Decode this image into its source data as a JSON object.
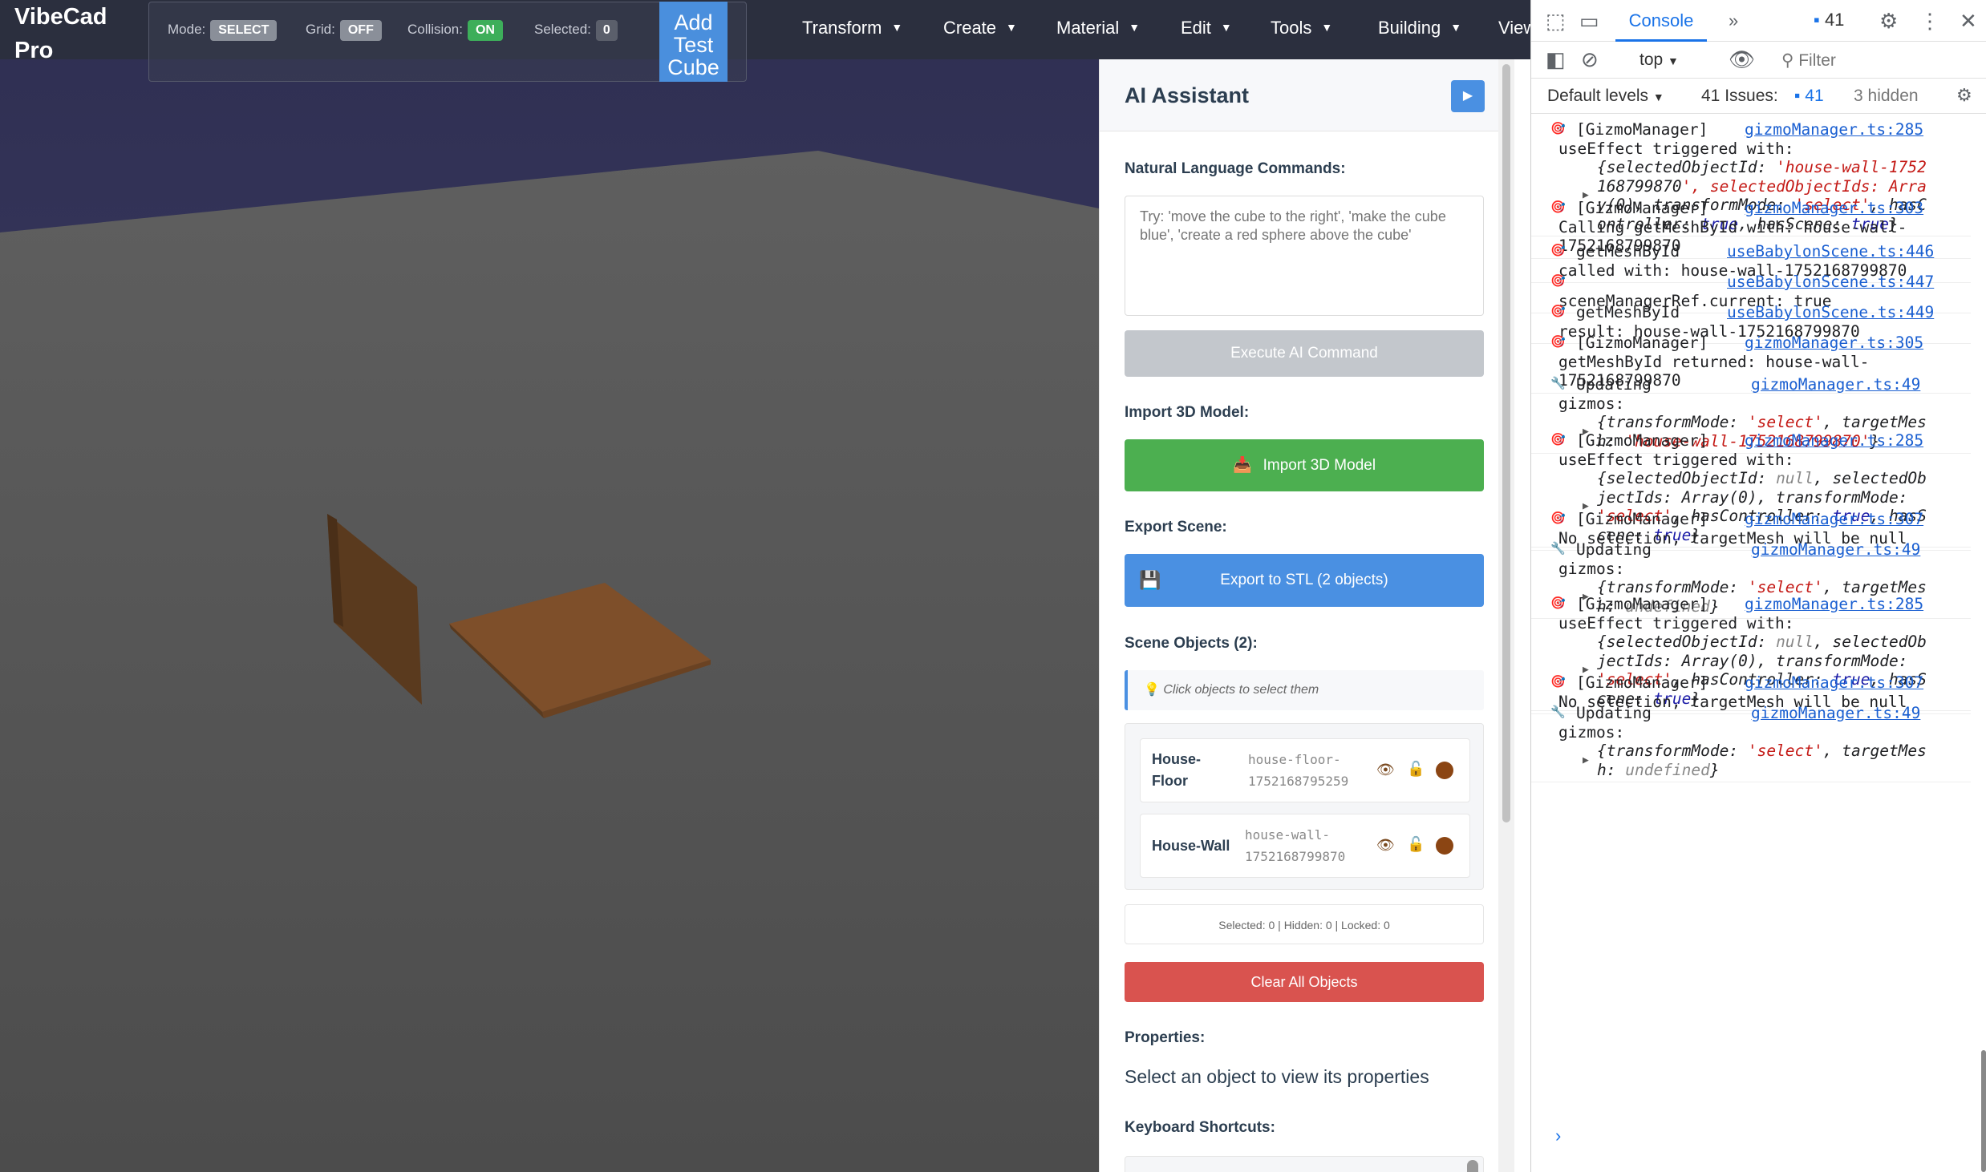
{
  "app": {
    "brand": "VibeCad Pro",
    "status": {
      "mode_label": "Mode:",
      "mode_value": "SELECT",
      "grid_label": "Grid:",
      "grid_value": "OFF",
      "collision_label": "Collision:",
      "collision_value": "ON",
      "selected_label": "Selected:",
      "selected_value": "0"
    },
    "add_cube_label": "Add Test Cube",
    "menus": [
      "Transform",
      "Create",
      "Material",
      "Edit",
      "Tools",
      "Building",
      "View"
    ]
  },
  "panel": {
    "title": "AI Assistant",
    "run_icon": "play-icon",
    "nl_label": "Natural Language Commands:",
    "nl_placeholder": "Try: 'move the cube to the right', 'make the cube blue', 'create a red sphere above the cube'",
    "execute_label": "Execute AI Command",
    "import_section": "Import 3D Model:",
    "import_label": "Import 3D Model",
    "export_section": "Export Scene:",
    "export_label": "Export to STL (2 objects)",
    "scene_objects_label": "Scene Objects (2):",
    "hint": "Click objects to select them",
    "objects": [
      {
        "name": "House-Floor",
        "id": "house-floor-1752168795259",
        "color": "#8b4513"
      },
      {
        "name": "House-Wall",
        "id": "house-wall-1752168799870",
        "color": "#8b4513"
      }
    ],
    "stats": "Selected: 0 | Hidden: 0 | Locked: 0",
    "clear_label": "Clear All Objects",
    "properties_label": "Properties:",
    "properties_text": "Select an object to view its properties",
    "shortcuts_label": "Keyboard Shortcuts:"
  },
  "devtools": {
    "console_tab": "Console",
    "message_count": "41",
    "context": "top",
    "filter_placeholder": "Filter",
    "levels": "Default levels",
    "issues_label": "41 Issues:",
    "issues_count": "41",
    "hidden": "3 hidden",
    "logs": [
      {
        "icon": "target",
        "lines": [
          "[GizmoManager]",
          "useEffect triggered with:"
        ],
        "src": "gizmoManager.ts:285",
        "detail": [
          "{selectedObjectId: 'house-wall-1752",
          "168799870', selectedObjectIds: Arra",
          "y(0), transformMode: 'select', hasC",
          "ontroller: true, hasScene: true}"
        ]
      },
      {
        "icon": "target",
        "lines": [
          "[GizmoManager]",
          "Calling getMeshById with: house-wall-",
          "1752168799870"
        ],
        "src": "gizmoManager.ts:303"
      },
      {
        "icon": "target",
        "lines": [
          "getMeshById",
          "called with: house-wall-1752168799870"
        ],
        "src": "useBabylonScene.ts:446"
      },
      {
        "icon": "target",
        "lines": [
          "",
          "sceneManagerRef.current: true"
        ],
        "src": "useBabylonScene.ts:447"
      },
      {
        "icon": "target",
        "lines": [
          "getMeshById",
          "result: house-wall-1752168799870"
        ],
        "src": "useBabylonScene.ts:449"
      },
      {
        "icon": "target",
        "lines": [
          "[GizmoManager]",
          "getMeshById returned: house-wall-",
          "1752168799870"
        ],
        "src": "gizmoManager.ts:305"
      },
      {
        "icon": "wrench",
        "lines": [
          "Updating",
          "gizmos:"
        ],
        "src": "gizmoManager.ts:49",
        "detail": [
          "{transformMode: 'select', targetMes",
          "h: 'house-wall-1752168799870'}"
        ]
      },
      {
        "icon": "target",
        "lines": [
          "[GizmoManager]",
          "useEffect triggered with:"
        ],
        "src": "gizmoManager.ts:285",
        "detail": [
          "{selectedObjectId: null, selectedOb",
          "jectIds: Array(0), transformMode:",
          "'select', hasController: true, hasS",
          "cene: true}"
        ]
      },
      {
        "icon": "target",
        "lines": [
          "[GizmoManager]",
          "No selection, targetMesh will be null"
        ],
        "src": "gizmoManager.ts:307"
      },
      {
        "icon": "wrench",
        "lines": [
          "Updating",
          "gizmos:"
        ],
        "src": "gizmoManager.ts:49",
        "detail": [
          "{transformMode: 'select', targetMes",
          "h: undefined}"
        ]
      },
      {
        "icon": "target",
        "lines": [
          "[GizmoManager]",
          "useEffect triggered with:"
        ],
        "src": "gizmoManager.ts:285",
        "detail": [
          "{selectedObjectId: null, selectedOb",
          "jectIds: Array(0), transformMode:",
          "'select', hasController: true, hasS",
          "cene: true}"
        ]
      },
      {
        "icon": "target",
        "lines": [
          "[GizmoManager]",
          "No selection, targetMesh will be null"
        ],
        "src": "gizmoManager.ts:307"
      },
      {
        "icon": "wrench",
        "lines": [
          "Updating",
          "gizmos:"
        ],
        "src": "gizmoManager.ts:49",
        "detail": [
          "{transformMode: 'select', targetMes",
          "h: undefined}"
        ]
      }
    ]
  },
  "colors": {
    "accent": "#4a90e2",
    "success": "#4caf50",
    "danger": "#d9534f",
    "object_brown": "#8b4513"
  }
}
